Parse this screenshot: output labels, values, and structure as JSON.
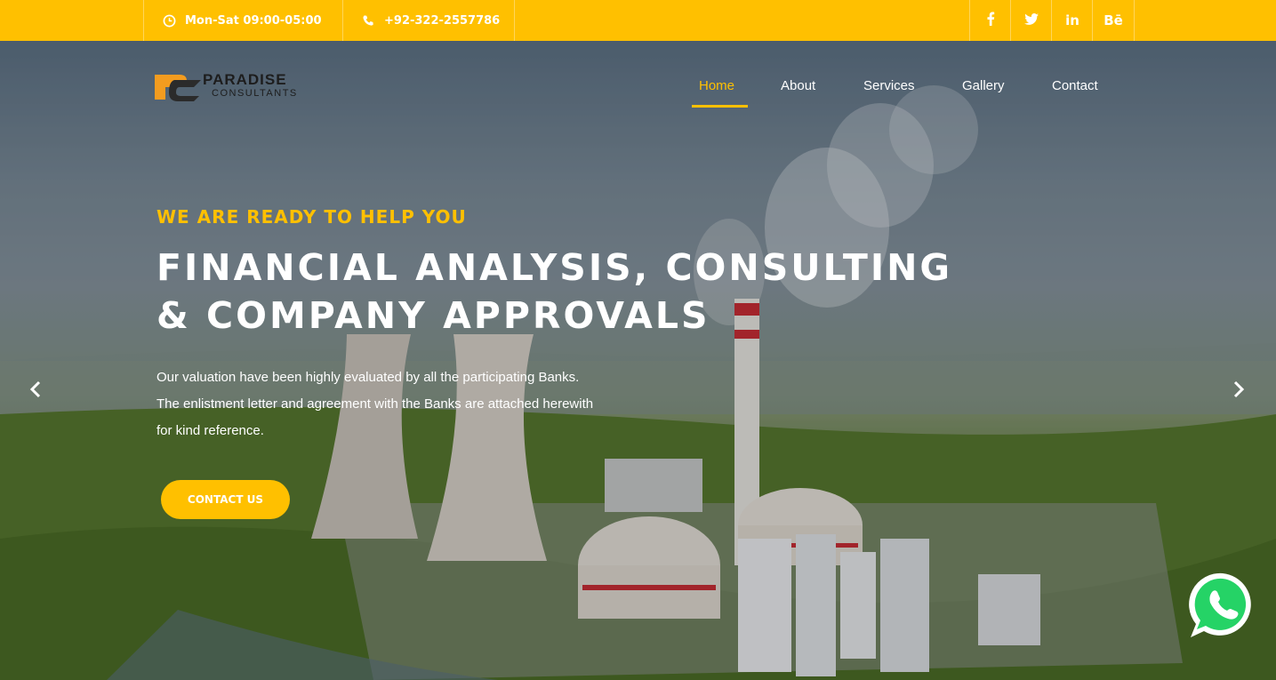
{
  "topbar": {
    "hours": "Mon-Sat 09:00-05:00",
    "phone": "+92-322-2557786",
    "social": [
      {
        "icon": "facebook-icon",
        "glyph": "f"
      },
      {
        "icon": "twitter-icon",
        "glyph": "t"
      },
      {
        "icon": "linkedin-icon",
        "glyph": "in"
      },
      {
        "icon": "behance-icon",
        "glyph": "Bē"
      }
    ],
    "color": "#ffc000"
  },
  "logo": {
    "name": "PARADISE",
    "sub": "CONSULTANTS"
  },
  "nav": {
    "items": [
      "Home",
      "About",
      "Services",
      "Gallery",
      "Contact"
    ],
    "active": "Home"
  },
  "hero": {
    "eyebrow": "WE ARE READY TO HELP YOU",
    "headline_1": "FINANCIAL ANALYSIS, CONSULTING",
    "headline_2": "& COMPANY APPROVALS",
    "desc_1": "Our valuation have been highly evaluated by all the participating Banks.",
    "desc_2": "The enlistment letter and agreement with the Banks are attached herewith",
    "desc_3": "for kind reference.",
    "cta": "CONTACT US"
  },
  "colors": {
    "accent": "#ffc000",
    "whatsapp": "#25d366"
  }
}
